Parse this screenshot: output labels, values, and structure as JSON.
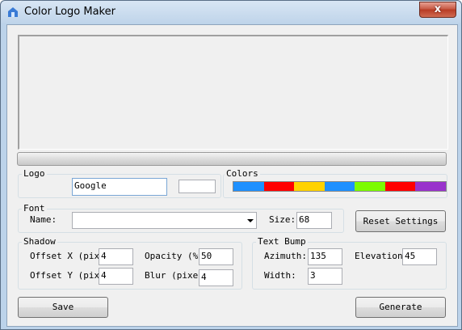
{
  "window": {
    "title": "Color Logo Maker",
    "close_glyph": "x"
  },
  "logo": {
    "group_label": "Logo",
    "text_value": "Google",
    "extra_value": ""
  },
  "colors": {
    "group_label": "Colors",
    "swatches": [
      "#1e90ff",
      "#ff0000",
      "#ffd200",
      "#1e90ff",
      "#7cfc00",
      "#ff0000",
      "#9932cc"
    ]
  },
  "font": {
    "group_label": "Font",
    "name_label": "Name:",
    "name_value": "",
    "size_label": "Size:",
    "size_value": "68"
  },
  "buttons": {
    "reset": "Reset Settings",
    "save": "Save",
    "generate": "Generate"
  },
  "shadow": {
    "group_label": "Shadow",
    "offset_x_label": "Offset X (pixe",
    "offset_x_value": "4",
    "offset_y_label": "Offset Y (pixe",
    "offset_y_value": "4",
    "opacity_label": "Opacity (%)",
    "opacity_value": "50",
    "blur_label": "Blur (pixel",
    "blur_value": "4"
  },
  "bump": {
    "group_label": "Text Bump",
    "azimuth_label": "Azimuth:",
    "azimuth_value": "135",
    "elevation_label": "Elevation:",
    "elevation_value": "45",
    "width_label": "Width:",
    "width_value": "3"
  }
}
